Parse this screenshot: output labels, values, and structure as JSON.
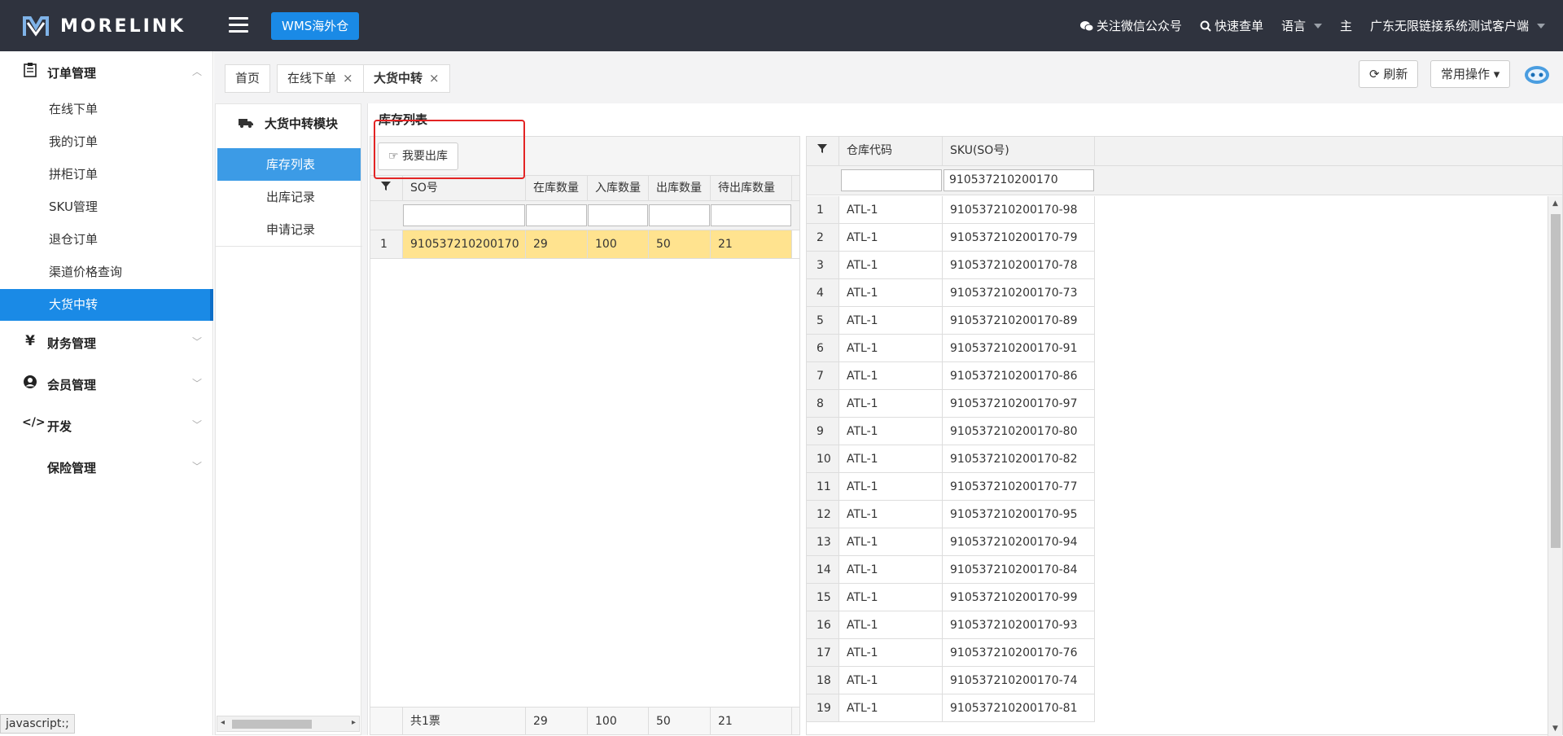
{
  "header": {
    "logo_text": "MORELINK",
    "wms_button": "WMS海外仓",
    "wechat": "关注微信公众号",
    "quick_query": "快速查单",
    "language": "语言",
    "theme": "主",
    "account": "广东无限链接系统测试客户端"
  },
  "sidebar": {
    "groups": [
      {
        "label": "订单管理",
        "icon": "order-icon"
      },
      {
        "label": "财务管理",
        "icon": "yen-icon"
      },
      {
        "label": "会员管理",
        "icon": "user-icon"
      },
      {
        "label": "开发",
        "icon": "code-icon"
      },
      {
        "label": "保险管理",
        "icon": ""
      }
    ],
    "items": [
      "在线下单",
      "我的订单",
      "拼柜订单",
      "SKU管理",
      "退仓订单",
      "渠道价格查询",
      "大货中转"
    ],
    "active_item": "大货中转"
  },
  "tabs": [
    {
      "label": "首页"
    },
    {
      "label": "在线下单",
      "close": "×"
    },
    {
      "label": "大货中转",
      "close": "×"
    }
  ],
  "top_actions": {
    "refresh": "刷新",
    "common_ops": "常用操作"
  },
  "module": {
    "title": "大货中转模块",
    "items": [
      "库存列表",
      "出库记录",
      "申请记录"
    ],
    "active": "库存列表"
  },
  "main": {
    "title": "库存列表",
    "out_button": "我要出库"
  },
  "grid1": {
    "columns": [
      "SO号",
      "在库数量",
      "入库数量",
      "出库数量",
      "待出库数量"
    ],
    "rows": [
      {
        "no": "1",
        "so": "910537210200170",
        "in_stock": "29",
        "inbound": "100",
        "outbound": "50",
        "pending": "21"
      }
    ],
    "footer": {
      "label": "共1票",
      "in_stock": "29",
      "inbound": "100",
      "outbound": "50",
      "pending": "21"
    }
  },
  "grid2": {
    "columns": [
      "仓库代码",
      "SKU(SO号)"
    ],
    "filter_sku": "910537210200170",
    "rows": [
      {
        "no": "1",
        "wh": "ATL-1",
        "sku": "910537210200170-98"
      },
      {
        "no": "2",
        "wh": "ATL-1",
        "sku": "910537210200170-79"
      },
      {
        "no": "3",
        "wh": "ATL-1",
        "sku": "910537210200170-78"
      },
      {
        "no": "4",
        "wh": "ATL-1",
        "sku": "910537210200170-73"
      },
      {
        "no": "5",
        "wh": "ATL-1",
        "sku": "910537210200170-89"
      },
      {
        "no": "6",
        "wh": "ATL-1",
        "sku": "910537210200170-91"
      },
      {
        "no": "7",
        "wh": "ATL-1",
        "sku": "910537210200170-86"
      },
      {
        "no": "8",
        "wh": "ATL-1",
        "sku": "910537210200170-97"
      },
      {
        "no": "9",
        "wh": "ATL-1",
        "sku": "910537210200170-80"
      },
      {
        "no": "10",
        "wh": "ATL-1",
        "sku": "910537210200170-82"
      },
      {
        "no": "11",
        "wh": "ATL-1",
        "sku": "910537210200170-77"
      },
      {
        "no": "12",
        "wh": "ATL-1",
        "sku": "910537210200170-95"
      },
      {
        "no": "13",
        "wh": "ATL-1",
        "sku": "910537210200170-94"
      },
      {
        "no": "14",
        "wh": "ATL-1",
        "sku": "910537210200170-84"
      },
      {
        "no": "15",
        "wh": "ATL-1",
        "sku": "910537210200170-99"
      },
      {
        "no": "16",
        "wh": "ATL-1",
        "sku": "910537210200170-93"
      },
      {
        "no": "17",
        "wh": "ATL-1",
        "sku": "910537210200170-76"
      },
      {
        "no": "18",
        "wh": "ATL-1",
        "sku": "910537210200170-74"
      },
      {
        "no": "19",
        "wh": "ATL-1",
        "sku": "910537210200170-81"
      }
    ]
  },
  "status_bar": "javascript:;"
}
